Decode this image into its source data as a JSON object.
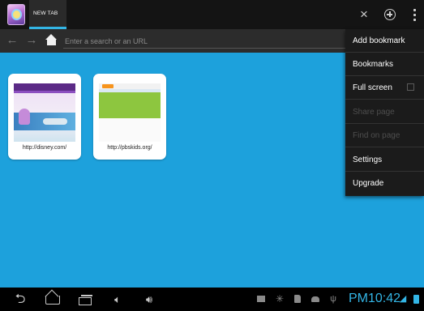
{
  "tabs": [
    {
      "label": "NEW TAB",
      "active": true
    }
  ],
  "toolbar": {
    "close_icon": "close-icon",
    "new_tab_icon": "plus-circle-icon",
    "overflow_icon": "overflow-menu-icon"
  },
  "urlbar": {
    "placeholder": "Enter a search or an URL",
    "value": ""
  },
  "speed_dial": [
    {
      "url": "http://disney.com/"
    },
    {
      "url": "http://pbskids.org/"
    }
  ],
  "menu": {
    "items": [
      {
        "label": "Add bookmark",
        "enabled": true
      },
      {
        "label": "Bookmarks",
        "enabled": true
      },
      {
        "label": "Full screen",
        "enabled": true,
        "checkbox": true,
        "checked": false
      },
      {
        "label": "Share page",
        "enabled": false
      },
      {
        "label": "Find on page",
        "enabled": false
      },
      {
        "label": "Settings",
        "enabled": true
      },
      {
        "label": "Upgrade",
        "enabled": true
      }
    ]
  },
  "status_bar": {
    "clock": "PM10:42"
  },
  "colors": {
    "accent": "#33b5e5",
    "content_background": "#1da1dc",
    "menu_background": "#1b1b1b"
  }
}
